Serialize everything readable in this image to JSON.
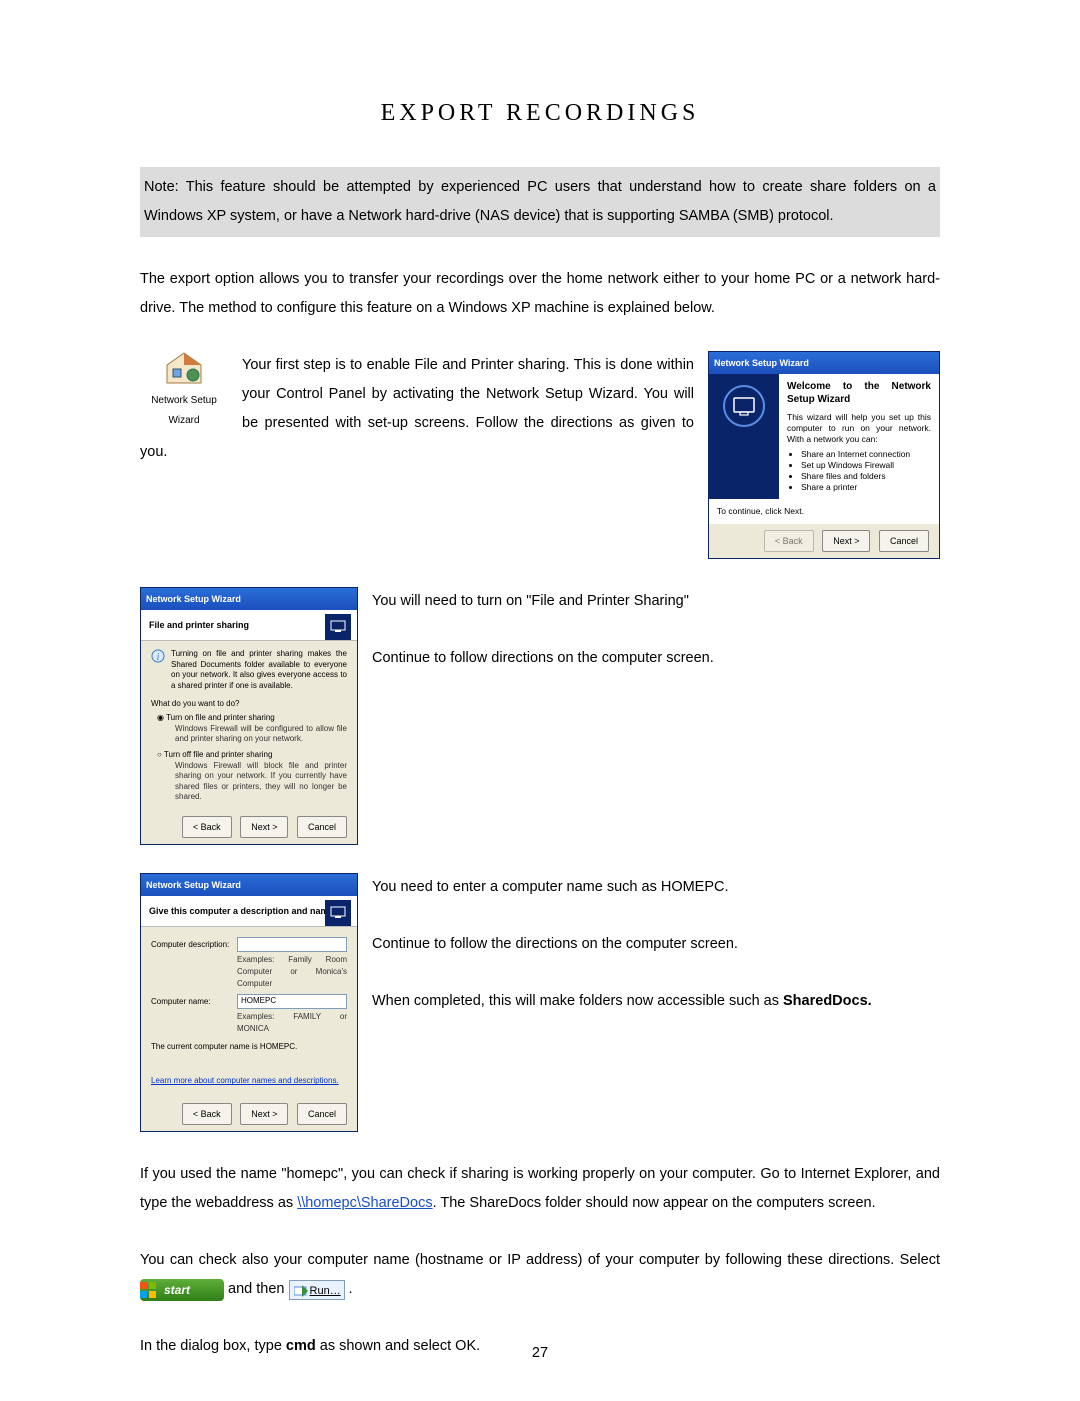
{
  "title": "EXPORT RECORDINGS",
  "note": "Note: This feature should be attempted by experienced PC users that understand how to create share folders on a Windows XP system, or have a Network hard-drive (NAS device) that is supporting SAMBA (SMB) protocol.",
  "intro": "The export option allows you to transfer your recordings over the home network either to your home PC or a network hard-drive.  The method to configure this feature on a Windows XP machine is explained below.",
  "wizard_icon_label": "Network Setup Wizard",
  "step1_text": "Your first step is to enable File and Printer sharing. This is done within your Control Panel by activating the Network Setup Wizard.  You will be presented with set-up screens. Follow the directions as given to you.",
  "welcome_dialog": {
    "titlebar": "Network Setup Wizard",
    "title": "Welcome to the Network Setup Wizard",
    "desc": "This wizard will help you set up this computer to run on your network. With a network you can:",
    "bullets": [
      "Share an Internet connection",
      "Set up Windows Firewall",
      "Share files and folders",
      "Share a printer"
    ],
    "continue": "To continue, click Next.",
    "back": "< Back",
    "next": "Next >",
    "cancel": "Cancel"
  },
  "fps_dialog": {
    "titlebar": "Network Setup Wizard",
    "subhead": "File and printer sharing",
    "info": "Turning on file and printer sharing makes the Shared Documents folder available to everyone on your network. It also gives everyone access to a shared printer if one is available.",
    "question": "What do you want to do?",
    "opt1": "Turn on file and printer sharing",
    "opt1_sub": "Windows Firewall will be configured to allow file and printer sharing on your network.",
    "opt2": "Turn off file and printer sharing",
    "opt2_sub": "Windows Firewall will block file and printer sharing on your network. If you currently have shared files or printers, they will no longer be shared.",
    "back": "< Back",
    "next": "Next >",
    "cancel": "Cancel"
  },
  "step2_line1": "You will need to turn on \"File and Printer Sharing\"",
  "step2_line2": "Continue to follow directions on the computer screen.",
  "cn_dialog": {
    "titlebar": "Network Setup Wizard",
    "subhead": "Give this computer a description and name.",
    "desc_label": "Computer description:",
    "desc_value": "",
    "desc_example": "Examples: Family Room Computer or Monica's Computer",
    "name_label": "Computer name:",
    "name_value": "HOMEPC",
    "name_example": "Examples: FAMILY or MONICA",
    "current": "The current computer name is HOMEPC.",
    "learn_more": "Learn more about computer names and descriptions.",
    "back": "< Back",
    "next": "Next >",
    "cancel": "Cancel"
  },
  "step3_line1": "You need to enter a computer name such as HOMEPC.",
  "step3_line2": "Continue to follow the directions on the computer screen.",
  "step3_line3_a": "When completed, this will make folders now accessible such as ",
  "step3_line3_b": "SharedDocs.",
  "para_check_pre": "If you used the name \"homepc\", you can check if sharing is working properly on your computer.  Go to Internet Explorer, and type the webaddress as ",
  "para_check_link": "\\\\homepc\\ShareDocs",
  "para_check_post": ". The ShareDocs folder should now appear on the computers screen.",
  "hostname_line_pre": "You can check also your computer name (hostname or IP address) of your computer by following these directions. Select ",
  "hostname_and_then": " and then ",
  "start_label": "start",
  "run_label": "Run…",
  "cmd_line_a": "In the dialog box, type ",
  "cmd_line_b": "cmd",
  "cmd_line_c": " as shown and select OK.",
  "page_number": "27"
}
